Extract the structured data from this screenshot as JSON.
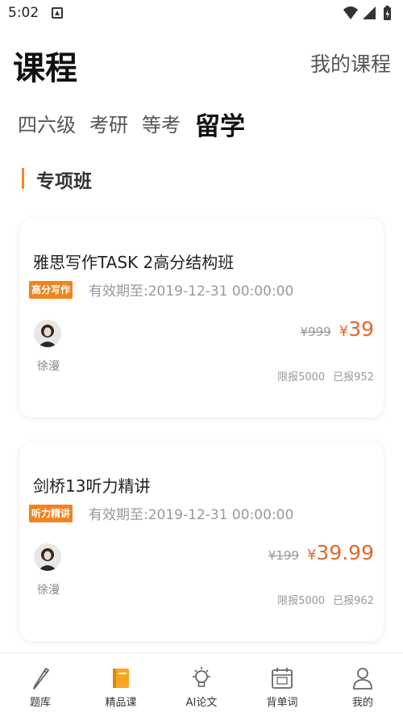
{
  "status_bar": {
    "time": "5:02"
  },
  "header": {
    "title": "课程",
    "my_courses": "我的课程"
  },
  "tabs": [
    {
      "label": "四六级",
      "active": false
    },
    {
      "label": "考研",
      "active": false
    },
    {
      "label": "等考",
      "active": false
    },
    {
      "label": "留学",
      "active": true
    }
  ],
  "section": {
    "title": "专项班"
  },
  "courses": [
    {
      "title": "雅思写作TASK 2高分结构班",
      "tag": "高分写作",
      "validity": "有效期至:2019-12-31 00:00:00",
      "teacher": "徐漫",
      "old_price": "¥999",
      "price_symbol": "¥",
      "price": "39",
      "limit": "限报5000",
      "enrolled": "已报952"
    },
    {
      "title": "剑桥13听力精讲",
      "tag": "听力精讲",
      "validity": "有效期至:2019-12-31 00:00:00",
      "teacher": "徐漫",
      "old_price": "¥199",
      "price_symbol": "¥",
      "price": "39.99",
      "limit": "限报5000",
      "enrolled": "已报962"
    }
  ],
  "bottom_nav": [
    {
      "label": "题库",
      "icon": "pencil-icon",
      "active": false
    },
    {
      "label": "精品课",
      "icon": "book-icon",
      "active": true
    },
    {
      "label": "AI论文",
      "icon": "bulb-icon",
      "active": false
    },
    {
      "label": "背单词",
      "icon": "calendar-icon",
      "active": false
    },
    {
      "label": "我的",
      "icon": "person-icon",
      "active": false
    }
  ],
  "colors": {
    "accent": "#f0831f",
    "price": "#e0692e",
    "nav_active": "#f5a623"
  }
}
